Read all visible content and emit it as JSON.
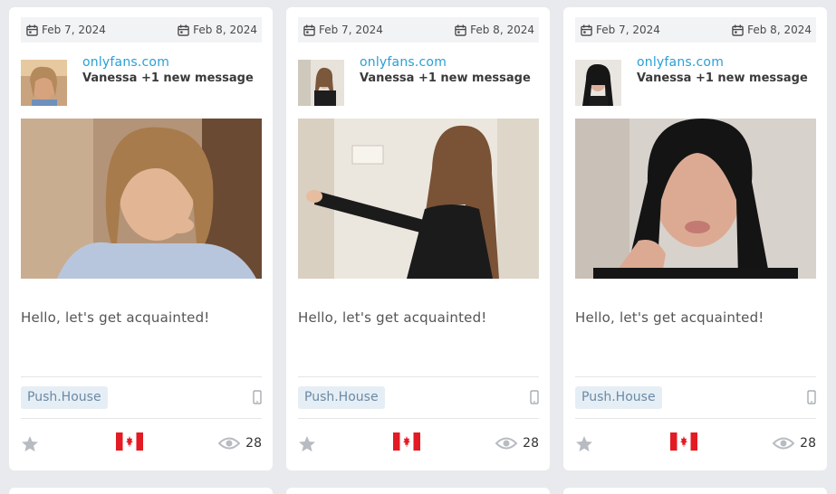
{
  "cards": [
    {
      "start_date": "Feb 7, 2024",
      "end_date": "Feb 8, 2024",
      "site": "onlyfans.com",
      "title": "Vanessa +1 new message",
      "text": "Hello, let's get acquainted!",
      "network": "Push.House",
      "views": "28",
      "country": "Canada",
      "device_icon": "mobile-phone-icon"
    },
    {
      "start_date": "Feb 7, 2024",
      "end_date": "Feb 8, 2024",
      "site": "onlyfans.com",
      "title": "Vanessa +1 new message",
      "text": "Hello, let's get acquainted!",
      "network": "Push.House",
      "views": "28",
      "country": "Canada",
      "device_icon": "mobile-phone-icon"
    },
    {
      "start_date": "Feb 7, 2024",
      "end_date": "Feb 8, 2024",
      "site": "onlyfans.com",
      "title": "Vanessa +1 new message",
      "text": "Hello, let's get acquainted!",
      "network": "Push.House",
      "views": "28",
      "country": "Canada",
      "device_icon": "mobile-phone-icon"
    }
  ],
  "colors": {
    "link": "#2a9fd6",
    "tag_bg": "#e6eef5",
    "page_bg": "#e8eaed"
  }
}
